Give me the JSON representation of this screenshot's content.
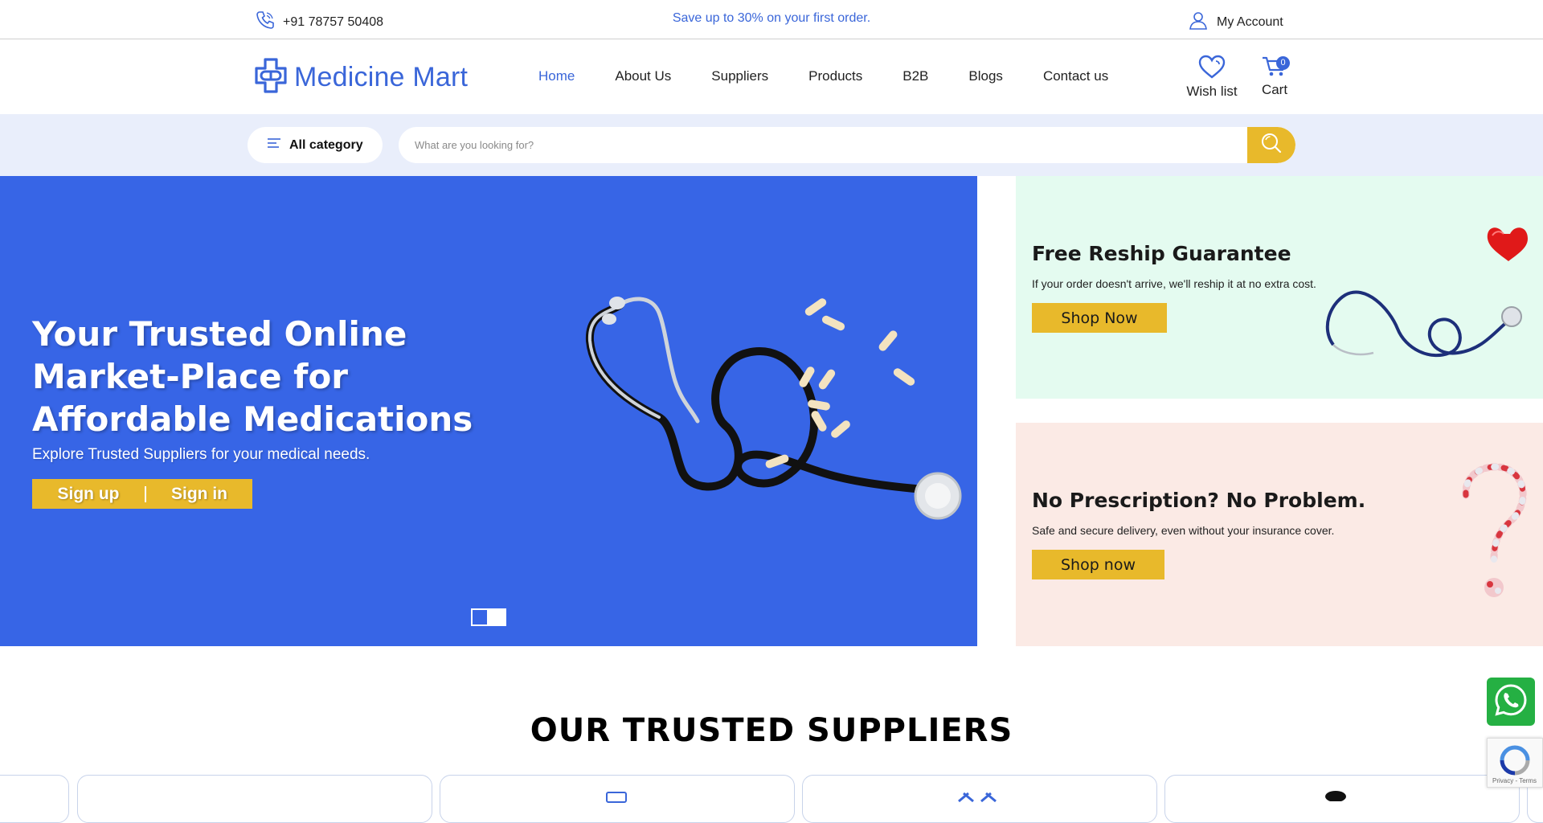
{
  "topbar": {
    "phone": "+91 78757 50408",
    "promo": "Save up to 30% on your first order.",
    "account": "My Account"
  },
  "header": {
    "logo_text": "Medicine Mart",
    "nav": [
      "Home",
      "About Us",
      "Suppliers",
      "Products",
      "B2B",
      "Blogs",
      "Contact us"
    ],
    "active_nav": "Home",
    "wishlist_label": "Wish list",
    "cart_label": "Cart",
    "cart_count": "0"
  },
  "search": {
    "category_label": "All category",
    "placeholder": "What are you looking for?"
  },
  "hero": {
    "title": "Your Trusted Online Market-Place for Affordable Medications",
    "subtitle": "Explore Trusted Suppliers for your medical needs.",
    "signup": "Sign up",
    "signin": "Sign in",
    "slide_count": 2,
    "active_slide": 1
  },
  "promos": [
    {
      "title": "Free Reship Guarantee",
      "text": "If your order doesn't arrive, we'll reship it at no extra cost.",
      "button": "Shop Now"
    },
    {
      "title": "No Prescription? No Problem.",
      "text": "Safe and secure delivery, even without your insurance cover.",
      "button": "Shop now"
    }
  ],
  "suppliers": {
    "title": "OUR TRUSTED SUPPLIERS"
  },
  "recaptcha": {
    "text": "Privacy - Terms"
  },
  "colors": {
    "brand_blue": "#3a66d9",
    "hero_blue": "#3765e6",
    "accent_yellow": "#e8b92b",
    "mint": "#e4fbf0",
    "peach": "#fbeae5",
    "whatsapp_green": "#25b043"
  }
}
